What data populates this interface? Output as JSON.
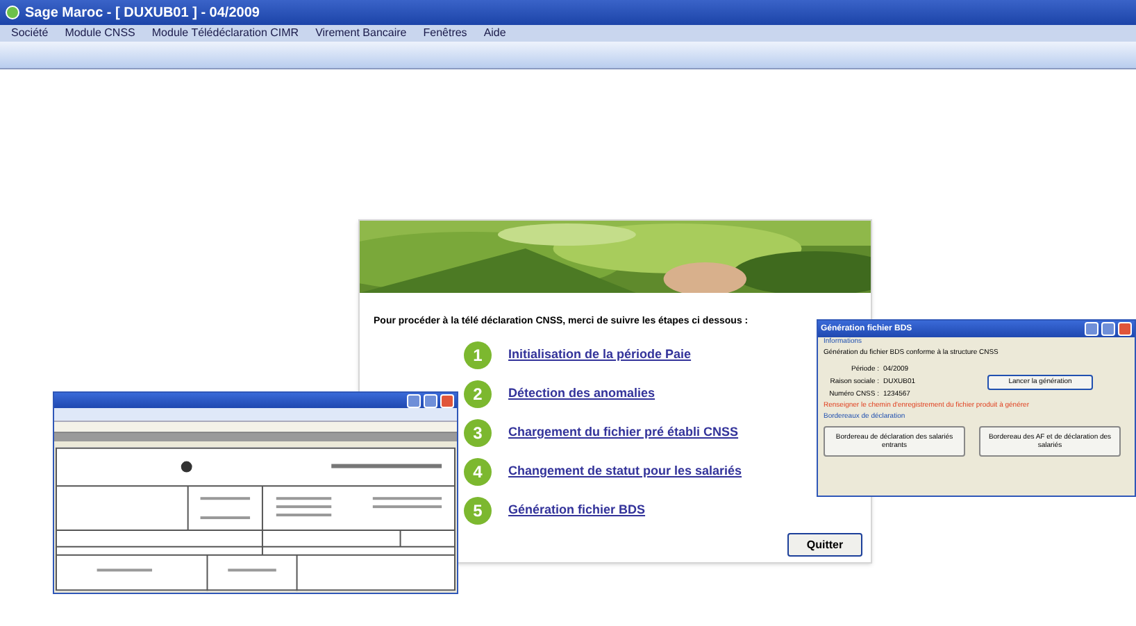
{
  "window": {
    "title": "Sage Maroc - [ DUXUB01 ] - 04/2009"
  },
  "menu": [
    "Société",
    "Module CNSS",
    "Module Télédéclaration CIMR",
    "Virement Bancaire",
    "Fenêtres",
    "Aide"
  ],
  "wizard": {
    "intro": "Pour procéder à la télé déclaration CNSS, merci de suivre les étapes ci dessous :",
    "steps": [
      {
        "number": "1",
        "label": "Initialisation de la période Paie"
      },
      {
        "number": "2",
        "label": "Détection des anomalies"
      },
      {
        "number": "3",
        "label": "Chargement du fichier pré établi CNSS"
      },
      {
        "number": "4",
        "label": "Changement de statut pour les salariés"
      },
      {
        "number": "5",
        "label": "Génération fichier BDS"
      }
    ],
    "quit_button": "Quitter"
  },
  "bds_dialog": {
    "title": "Génération fichier BDS",
    "info_legend": "Informations",
    "info_text": "Génération du fichier BDS conforme à la structure CNSS",
    "fields": [
      {
        "label": "Période :",
        "value": "04/2009"
      },
      {
        "label": "Raison sociale :",
        "value": "DUXUB01"
      },
      {
        "label": "Numéro CNSS :",
        "value": "1234567"
      }
    ],
    "launch_button": "Lancer la génération",
    "warning": "Renseigner le chemin d'enregistrement du fichier produit à générer",
    "slips_legend": "Bordereaux de déclaration",
    "slip_buttons": [
      "Bordereau de déclaration des salariés entrants",
      "Bordereau des AF et de déclaration des salariés"
    ]
  }
}
